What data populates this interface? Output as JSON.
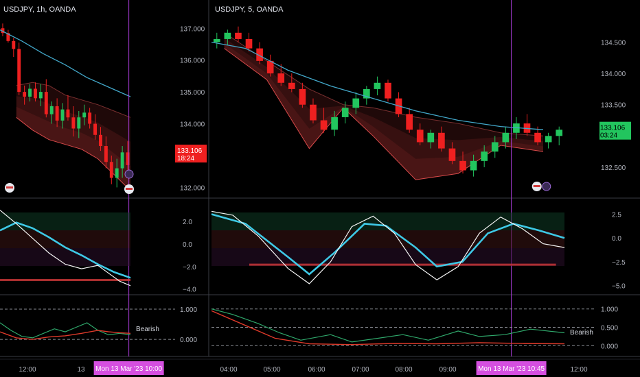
{
  "colors": {
    "bg": "#000000",
    "bull": "#22c55e",
    "bear": "#ef2020",
    "ma": "#42a7c9",
    "band_edge": "#d84a4a",
    "osc_white": "#f4f4f4",
    "osc_cyan": "#3ec9e6",
    "osc_red": "#f03a3a",
    "crosshair": "#a83cd6",
    "tag_magenta": "#d54fe0",
    "grid": "#3a3d45",
    "dashed": "#8a8d94",
    "lower_green": "#2fa86b",
    "lower_red": "#e03a2a"
  },
  "chart_data": [
    {
      "id": "left",
      "title": "USDJPY, 1h, OANDA",
      "type": "candlestick",
      "y_ticks": [
        "137.000",
        "136.000",
        "135.000",
        "134.000",
        "133.000",
        "132.000"
      ],
      "ylim": [
        131.75,
        137.35
      ],
      "x_ticks": [
        "12:00",
        "13"
      ],
      "x_range": [
        0,
        24
      ],
      "crosshair_x": 23.7,
      "crosshair_label": "Mon 13 Mar '23   10:00",
      "price_tag": {
        "value": "133.106",
        "timer": "18:24"
      },
      "candles": [
        [
          137.0,
          137.15,
          136.75,
          136.85
        ],
        [
          136.85,
          136.95,
          136.55,
          136.6
        ],
        [
          136.6,
          136.7,
          136.1,
          136.35
        ],
        [
          136.35,
          136.55,
          134.9,
          135.0
        ],
        [
          135.0,
          135.2,
          134.6,
          134.85
        ],
        [
          134.85,
          135.25,
          134.7,
          135.1
        ],
        [
          135.1,
          135.3,
          134.7,
          134.8
        ],
        [
          134.8,
          135.25,
          134.55,
          135.0
        ],
        [
          135.0,
          135.4,
          134.2,
          134.3
        ],
        [
          134.3,
          134.7,
          134.0,
          134.55
        ],
        [
          134.55,
          134.8,
          133.9,
          134.1
        ],
        [
          134.1,
          134.65,
          133.85,
          134.45
        ],
        [
          134.45,
          134.9,
          134.1,
          134.2
        ],
        [
          134.2,
          134.55,
          133.6,
          133.85
        ],
        [
          133.85,
          134.4,
          133.55,
          134.2
        ],
        [
          134.2,
          134.6,
          133.95,
          134.35
        ],
        [
          134.35,
          134.5,
          133.85,
          134.0
        ],
        [
          134.0,
          134.3,
          133.5,
          133.65
        ],
        [
          133.65,
          133.9,
          133.15,
          133.3
        ],
        [
          133.3,
          133.6,
          132.6,
          132.8
        ],
        [
          132.8,
          133.0,
          132.1,
          132.3
        ],
        [
          132.3,
          132.9,
          132.0,
          132.6
        ],
        [
          132.6,
          133.3,
          132.3,
          133.1
        ],
        [
          133.1,
          133.45,
          132.5,
          132.7
        ]
      ],
      "ma": [
        [
          0,
          136.95
        ],
        [
          4,
          136.6
        ],
        [
          8,
          136.2
        ],
        [
          12,
          135.85
        ],
        [
          16,
          135.45
        ],
        [
          20,
          135.15
        ],
        [
          24,
          134.85
        ]
      ],
      "band_upper": [
        [
          3,
          135.2
        ],
        [
          6,
          135.3
        ],
        [
          9,
          135.2
        ],
        [
          12,
          134.9
        ],
        [
          15,
          134.75
        ],
        [
          18,
          134.6
        ],
        [
          21,
          134.4
        ],
        [
          24,
          134.2
        ]
      ],
      "band_lower": [
        [
          3,
          134.2
        ],
        [
          6,
          133.8
        ],
        [
          9,
          133.5
        ],
        [
          12,
          133.35
        ],
        [
          15,
          133.2
        ],
        [
          18,
          132.9
        ],
        [
          21,
          132.4
        ],
        [
          24,
          131.9
        ]
      ],
      "osc": {
        "y_ticks": [
          "2.0",
          "0.0",
          "−2.0",
          "−4.0"
        ],
        "ylim": [
          -4.2,
          3.4
        ],
        "white": [
          [
            0,
            3.0
          ],
          [
            3,
            1.8
          ],
          [
            6,
            0.5
          ],
          [
            9,
            -0.8
          ],
          [
            12,
            -1.8
          ],
          [
            15,
            -2.2
          ],
          [
            18,
            -1.9
          ],
          [
            20,
            -2.6
          ],
          [
            22,
            -3.3
          ],
          [
            24,
            -3.7
          ]
        ],
        "cyan": [
          [
            0,
            1.2
          ],
          [
            3,
            1.9
          ],
          [
            6,
            1.4
          ],
          [
            9,
            0.6
          ],
          [
            12,
            -0.3
          ],
          [
            15,
            -1.0
          ],
          [
            18,
            -1.8
          ],
          [
            21,
            -2.5
          ],
          [
            24,
            -3.0
          ]
        ],
        "red_segment": [
          9.5,
          14.5
        ],
        "baseline": -3.2
      },
      "lower": {
        "y_ticks": [
          "1.000",
          "0.000"
        ],
        "ylim": [
          -0.45,
          1.25
        ],
        "label": "Bearish",
        "green": [
          [
            0,
            0.55
          ],
          [
            2,
            0.3
          ],
          [
            4,
            0.1
          ],
          [
            6,
            0.05
          ],
          [
            8,
            0.2
          ],
          [
            10,
            0.35
          ],
          [
            12,
            0.25
          ],
          [
            14,
            0.4
          ],
          [
            16,
            0.55
          ],
          [
            18,
            0.3
          ],
          [
            20,
            0.15
          ],
          [
            22,
            0.2
          ],
          [
            24,
            0.15
          ]
        ],
        "red": [
          [
            0,
            0.25
          ],
          [
            3,
            0.05
          ],
          [
            6,
            0.0
          ],
          [
            9,
            0.08
          ],
          [
            12,
            0.12
          ],
          [
            15,
            0.2
          ],
          [
            18,
            0.3
          ],
          [
            20,
            0.25
          ],
          [
            22,
            0.22
          ],
          [
            24,
            0.2
          ]
        ]
      }
    },
    {
      "id": "right",
      "title": "USDJPY, 5, OANDA",
      "type": "candlestick",
      "y_ticks": [
        "134.500",
        "134.000",
        "133.500",
        "132.500"
      ],
      "ylim": [
        132.05,
        134.9
      ],
      "x_ticks": [
        "04:00",
        "05:00",
        "06:00",
        "07:00",
        "08:00",
        "09:00",
        "10",
        "12:00"
      ],
      "x_range": [
        3.7,
        12.0
      ],
      "crosshair_x": 10.75,
      "crosshair_label": "Mon 13 Mar '23   10:45",
      "price_tag": {
        "value": "133.106",
        "timer": "03:24"
      },
      "candles": [
        [
          134.5,
          134.65,
          134.4,
          134.55
        ],
        [
          134.55,
          134.7,
          134.45,
          134.65
        ],
        [
          134.65,
          134.75,
          134.5,
          134.55
        ],
        [
          134.55,
          134.65,
          134.35,
          134.4
        ],
        [
          134.4,
          134.5,
          134.15,
          134.2
        ],
        [
          134.2,
          134.3,
          133.95,
          134.0
        ],
        [
          134.0,
          134.15,
          133.8,
          133.85
        ],
        [
          133.85,
          134.0,
          133.7,
          133.75
        ],
        [
          133.75,
          133.85,
          133.45,
          133.5
        ],
        [
          133.5,
          133.6,
          133.2,
          133.25
        ],
        [
          133.25,
          133.45,
          133.05,
          133.1
        ],
        [
          133.1,
          133.4,
          133.0,
          133.3
        ],
        [
          133.3,
          133.55,
          133.2,
          133.45
        ],
        [
          133.45,
          133.7,
          133.35,
          133.6
        ],
        [
          133.6,
          133.8,
          133.5,
          133.75
        ],
        [
          133.75,
          133.95,
          133.65,
          133.85
        ],
        [
          133.85,
          133.9,
          133.55,
          133.6
        ],
        [
          133.6,
          133.7,
          133.3,
          133.35
        ],
        [
          133.35,
          133.45,
          133.05,
          133.1
        ],
        [
          133.1,
          133.2,
          132.85,
          132.9
        ],
        [
          132.9,
          133.1,
          132.8,
          133.05
        ],
        [
          133.05,
          133.15,
          132.75,
          132.8
        ],
        [
          132.8,
          132.9,
          132.55,
          132.6
        ],
        [
          132.6,
          132.75,
          132.4,
          132.45
        ],
        [
          132.45,
          132.7,
          132.35,
          132.6
        ],
        [
          132.6,
          132.85,
          132.5,
          132.75
        ],
        [
          132.75,
          133.0,
          132.65,
          132.9
        ],
        [
          132.9,
          133.15,
          132.8,
          133.05
        ],
        [
          133.05,
          133.3,
          132.95,
          133.2
        ],
        [
          133.2,
          133.35,
          133.0,
          133.05
        ],
        [
          133.05,
          133.15,
          132.85,
          132.9
        ],
        [
          132.9,
          133.05,
          132.8,
          133.0
        ],
        [
          133.0,
          133.15,
          132.85,
          133.1
        ]
      ],
      "ma": [
        [
          3.7,
          134.5
        ],
        [
          4.5,
          134.4
        ],
        [
          5.5,
          134.05
        ],
        [
          6.5,
          133.8
        ],
        [
          7.5,
          133.6
        ],
        [
          8.5,
          133.4
        ],
        [
          9.5,
          133.25
        ],
        [
          10.5,
          133.15
        ],
        [
          11.5,
          133.1
        ]
      ],
      "band_upper": [
        [
          4.0,
          134.65
        ],
        [
          5.0,
          134.2
        ],
        [
          6.0,
          133.75
        ],
        [
          6.8,
          133.5
        ],
        [
          7.5,
          133.45
        ],
        [
          8.5,
          133.3
        ],
        [
          9.5,
          133.2
        ],
        [
          10.5,
          133.05
        ],
        [
          11.5,
          133.0
        ]
      ],
      "band_lower": [
        [
          4.0,
          134.4
        ],
        [
          5.0,
          133.9
        ],
        [
          6.0,
          132.8
        ],
        [
          6.8,
          133.45
        ],
        [
          7.5,
          133.0
        ],
        [
          8.5,
          132.3
        ],
        [
          9.5,
          132.4
        ],
        [
          10.5,
          132.85
        ],
        [
          11.5,
          132.75
        ]
      ],
      "osc": {
        "y_ticks": [
          "2.5",
          "0.0",
          "−2.5",
          "−5.0"
        ],
        "ylim": [
          -5.6,
          3.4
        ],
        "white": [
          [
            3.7,
            2.8
          ],
          [
            4.2,
            2.4
          ],
          [
            4.8,
            0.2
          ],
          [
            5.5,
            -3.2
          ],
          [
            6.0,
            -4.8
          ],
          [
            6.5,
            -2.5
          ],
          [
            7.0,
            1.2
          ],
          [
            7.5,
            2.3
          ],
          [
            8.0,
            0.5
          ],
          [
            8.5,
            -2.8
          ],
          [
            9.0,
            -4.4
          ],
          [
            9.5,
            -3.0
          ],
          [
            10.0,
            0.5
          ],
          [
            10.5,
            2.2
          ],
          [
            11.0,
            1.0
          ],
          [
            11.5,
            -0.6
          ],
          [
            12.0,
            -1.0
          ]
        ],
        "cyan": [
          [
            3.7,
            2.5
          ],
          [
            4.5,
            1.5
          ],
          [
            5.5,
            -2.0
          ],
          [
            6.0,
            -3.8
          ],
          [
            6.6,
            -1.5
          ],
          [
            7.3,
            1.5
          ],
          [
            7.8,
            1.3
          ],
          [
            8.5,
            -1.0
          ],
          [
            9.0,
            -3.0
          ],
          [
            9.6,
            -2.5
          ],
          [
            10.2,
            0.5
          ],
          [
            10.8,
            1.5
          ],
          [
            11.4,
            0.8
          ],
          [
            12.0,
            0.0
          ]
        ],
        "red_segment": [
          5.6,
          6.2
        ],
        "baseline": -2.8
      },
      "lower": {
        "y_ticks": [
          "1.000",
          "0.500",
          "0.000"
        ],
        "ylim": [
          -0.2,
          1.2
        ],
        "label": "Bearish",
        "green": [
          [
            3.7,
            1.0
          ],
          [
            4.2,
            0.85
          ],
          [
            4.8,
            0.6
          ],
          [
            5.3,
            0.35
          ],
          [
            5.8,
            0.15
          ],
          [
            6.5,
            0.3
          ],
          [
            7.0,
            0.1
          ],
          [
            7.6,
            0.2
          ],
          [
            8.2,
            0.3
          ],
          [
            8.8,
            0.15
          ],
          [
            9.5,
            0.4
          ],
          [
            10.0,
            0.25
          ],
          [
            10.6,
            0.3
          ],
          [
            11.2,
            0.45
          ],
          [
            12.0,
            0.35
          ]
        ],
        "red": [
          [
            3.7,
            0.95
          ],
          [
            4.5,
            0.55
          ],
          [
            5.2,
            0.2
          ],
          [
            6.0,
            0.05
          ],
          [
            7.0,
            0.03
          ],
          [
            8.0,
            0.06
          ],
          [
            9.0,
            0.05
          ],
          [
            10.0,
            0.08
          ],
          [
            11.0,
            0.06
          ],
          [
            12.0,
            0.05
          ]
        ]
      }
    }
  ]
}
